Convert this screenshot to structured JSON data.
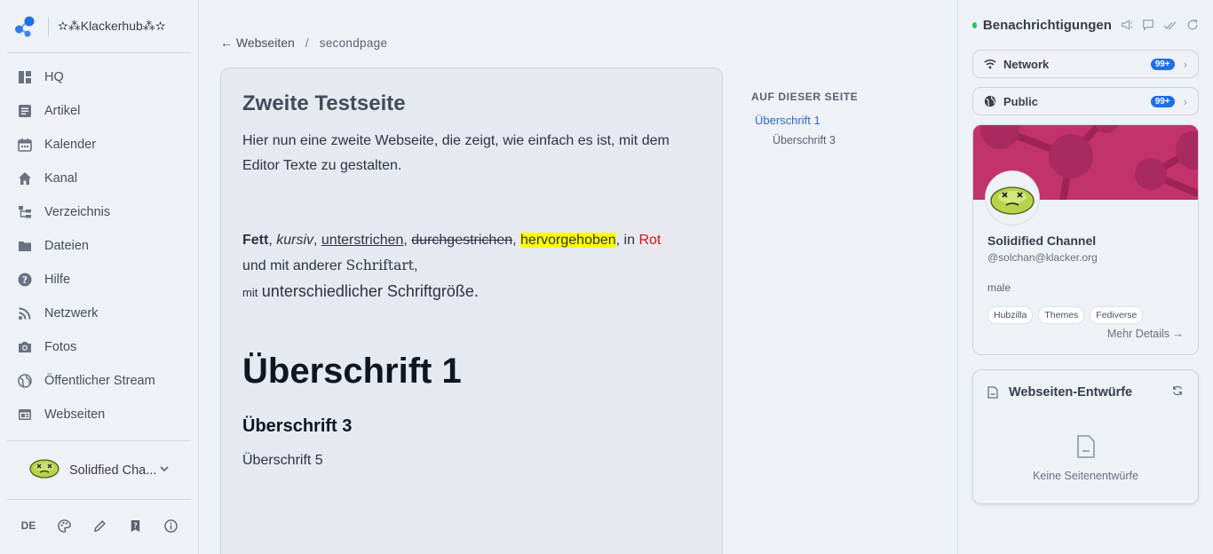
{
  "brand": {
    "name": "✫⁂Klackerhub⁂✫"
  },
  "sidebar": {
    "items": [
      {
        "label": "HQ",
        "icon": "dashboard-icon"
      },
      {
        "label": "Artikel",
        "icon": "article-icon"
      },
      {
        "label": "Kalender",
        "icon": "calendar-icon"
      },
      {
        "label": "Kanal",
        "icon": "home-icon"
      },
      {
        "label": "Verzeichnis",
        "icon": "directory-icon"
      },
      {
        "label": "Dateien",
        "icon": "folder-icon"
      },
      {
        "label": "Hilfe",
        "icon": "help-icon"
      },
      {
        "label": "Netzwerk",
        "icon": "rss-icon"
      },
      {
        "label": "Fotos",
        "icon": "photo-icon"
      },
      {
        "label": "Öffentlicher Stream",
        "icon": "globe-icon"
      },
      {
        "label": "Webseiten",
        "icon": "webpages-icon"
      }
    ],
    "profile_name": "Solidfied Cha...",
    "language": "DE"
  },
  "breadcrumb": {
    "back": "Webseiten",
    "separator": "/",
    "current": "secondpage"
  },
  "page": {
    "title": "Zweite Testseite",
    "intro": "Hier nun eine zweite Webseite, die zeigt, wie einfach es ist, mit dem Editor Texte zu gestalten.",
    "fmt": {
      "bold": "Fett",
      "italic": "kursiv",
      "underline": "unterstrichen",
      "strike": "durchgestrichen",
      "highlight": "hervorgehoben",
      "in": "in",
      "red": "Rot",
      "font_prefix": "und mit anderer",
      "font": "Schriftart",
      "small": "mit",
      "big": "unterschiedlicher Schriftgröße."
    },
    "h1": "Überschrift 1",
    "h3": "Überschrift 3",
    "h5": "Überschrift 5"
  },
  "toc": {
    "title": "AUF DIESER SEITE",
    "items": [
      "Überschrift 1",
      "Überschrift 3"
    ]
  },
  "notifications": {
    "title": "Benachrichtigungen",
    "network": {
      "label": "Network",
      "badge": "99+"
    },
    "public": {
      "label": "Public",
      "badge": "99+"
    }
  },
  "profile": {
    "name": "Solidified Channel",
    "handle": "@solchan@klacker.org",
    "gender": "male",
    "tags": [
      "Hubzilla",
      "Themes",
      "Fediverse"
    ],
    "more": "Mehr Details →"
  },
  "drafts": {
    "title": "Webseiten-Entwürfe",
    "empty": "Keine Seitenentwürfe"
  },
  "colors": {
    "accent": "#1f6fe5",
    "link": "#2d6bd6",
    "cover": "#c2336c",
    "online": "#22c55e",
    "highlight": "#ffff00",
    "red": "#e01010"
  }
}
